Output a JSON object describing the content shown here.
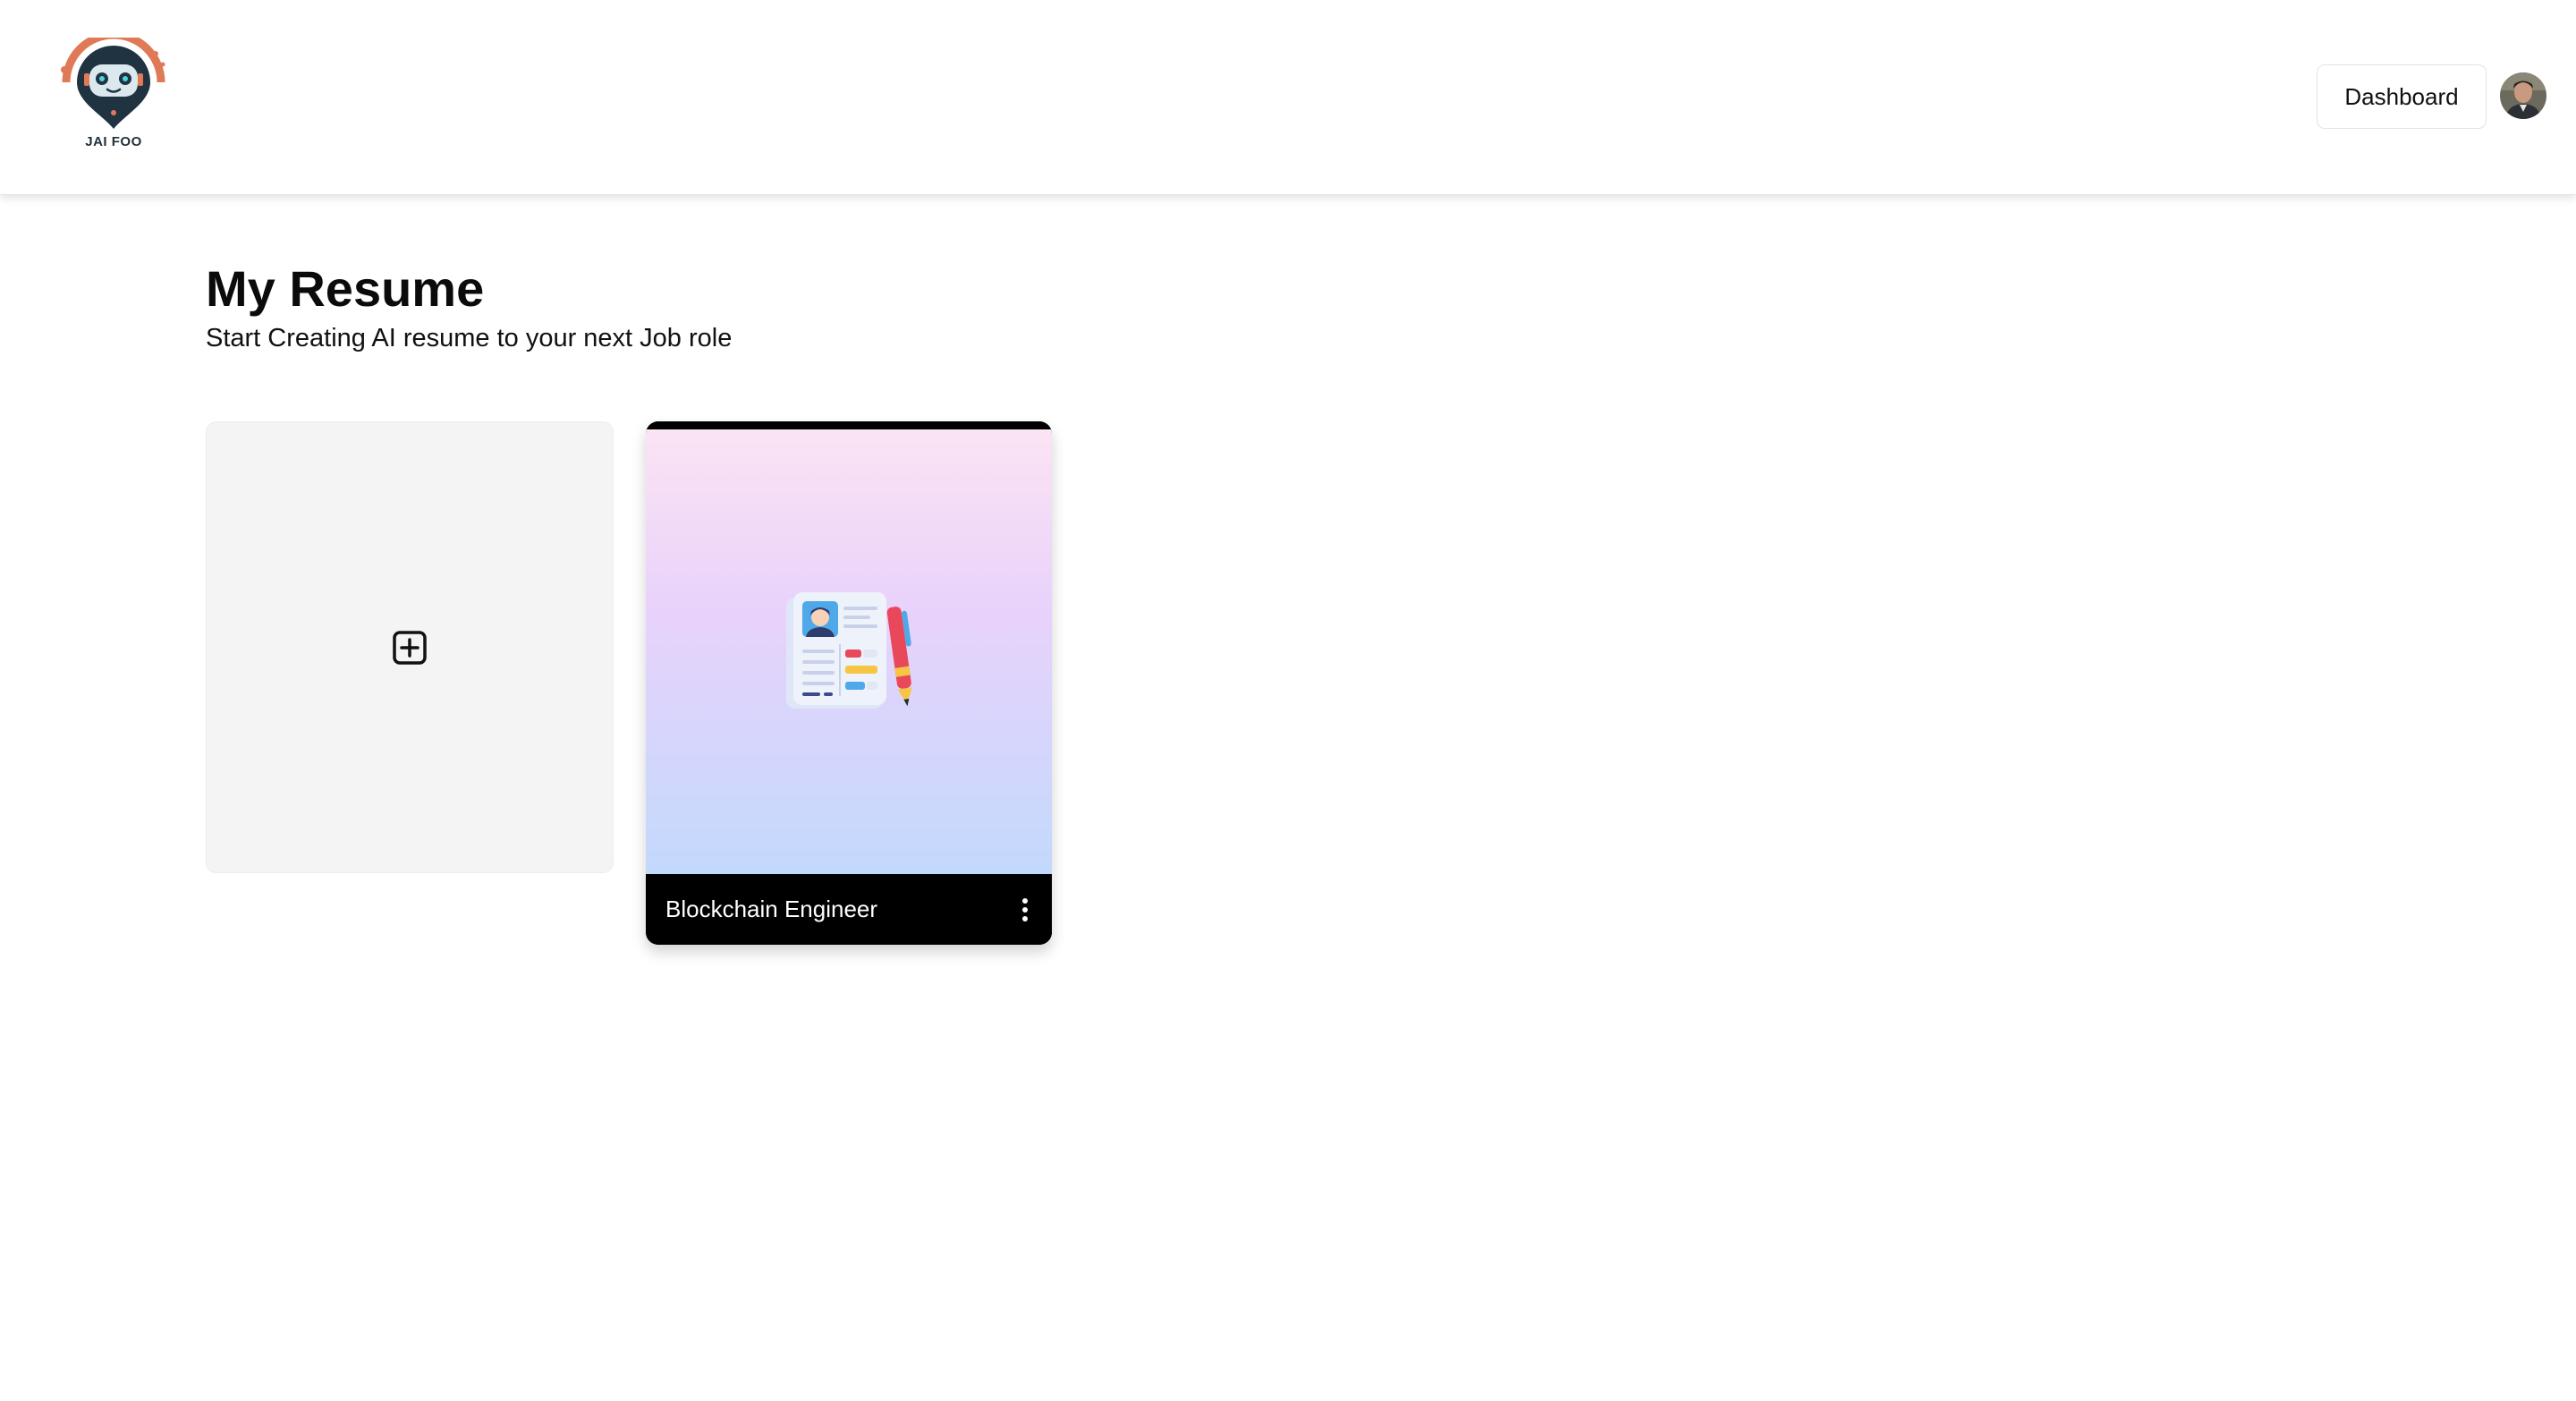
{
  "header": {
    "logo_text": "JAI FOO",
    "dashboard_label": "Dashboard"
  },
  "main": {
    "title": "My Resume",
    "subtitle": "Start Creating AI resume to your next Job role"
  },
  "resumes": [
    {
      "title": "Blockchain Engineer"
    }
  ],
  "colors": {
    "logo_accent": "#e07a56",
    "logo_dark": "#1f3340",
    "card_gradient_top": "#fbe4f3",
    "card_gradient_mid": "#e9d2fb",
    "card_gradient_bottom": "#c2d9fc"
  },
  "icons": {
    "add": "plus-square-icon",
    "more": "more-vertical-icon"
  }
}
